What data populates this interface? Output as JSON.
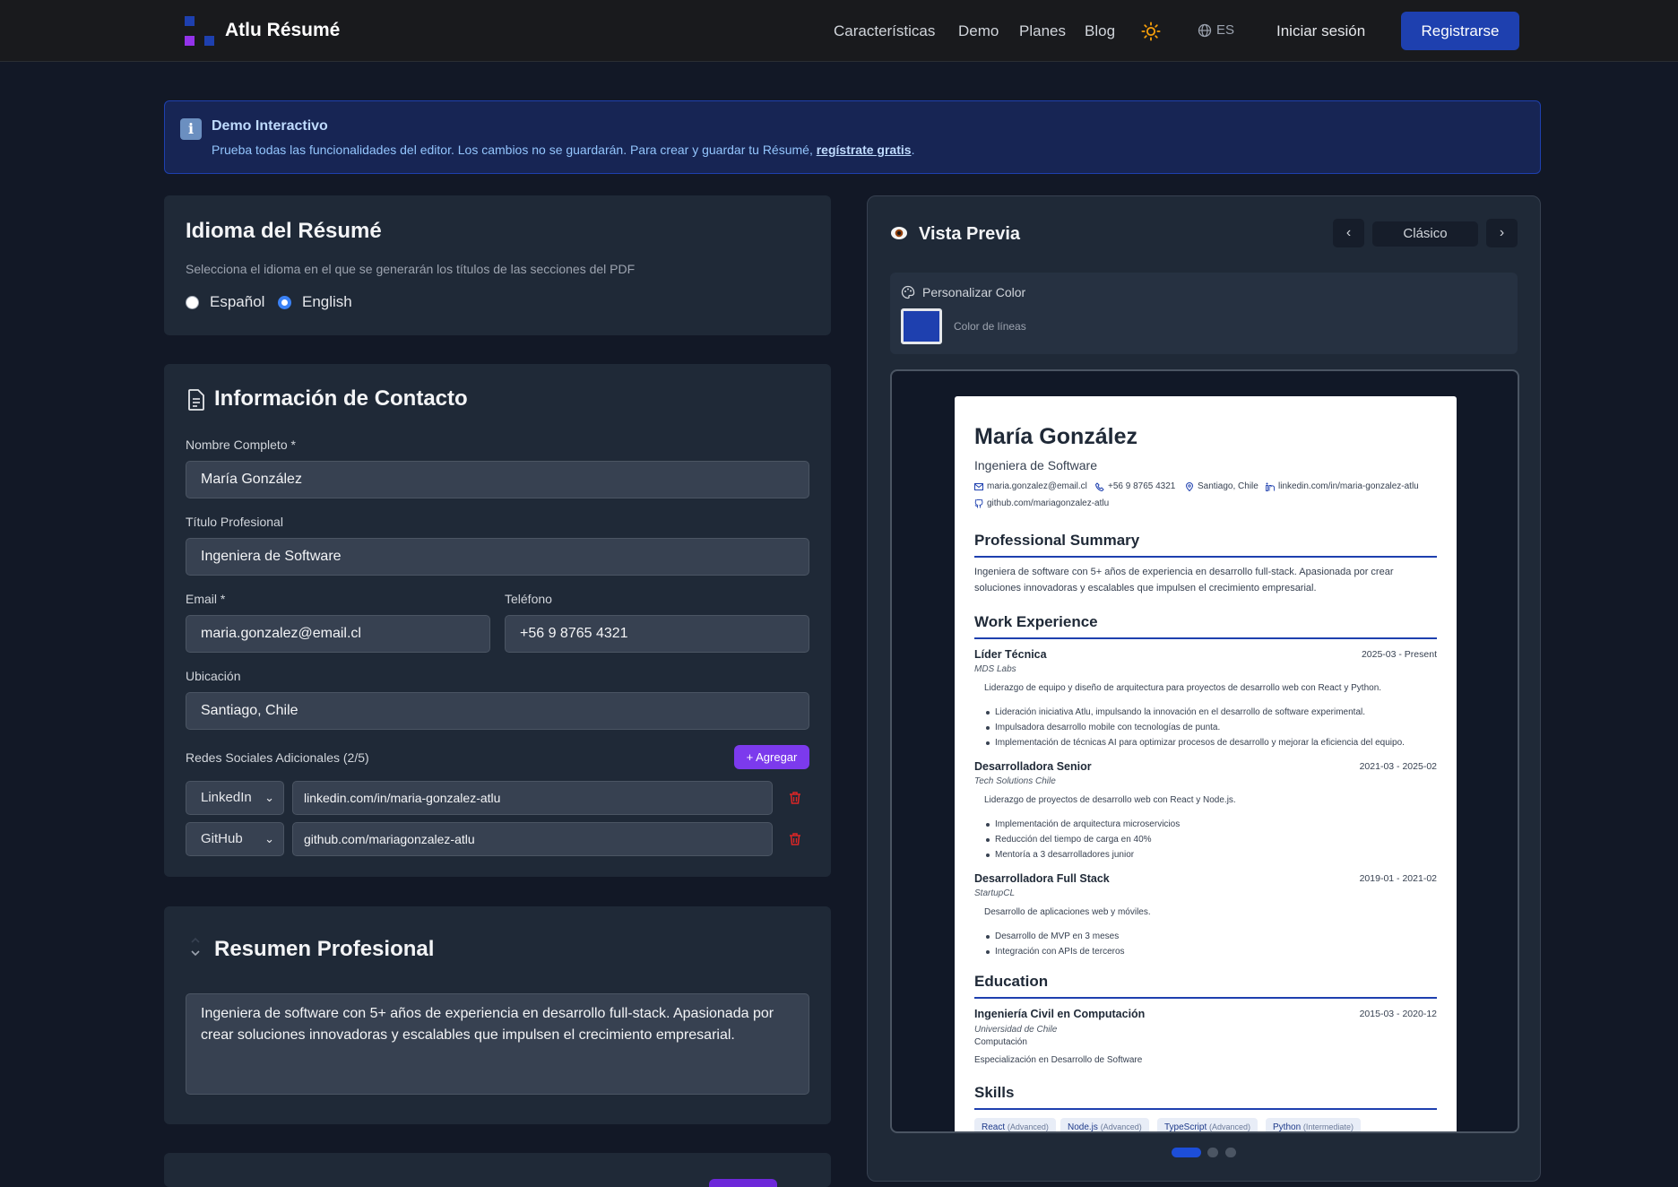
{
  "header": {
    "brand": "Atlu Résumé",
    "nav": [
      "Características",
      "Demo",
      "Planes",
      "Blog"
    ],
    "language": "ES",
    "login": "Iniciar sesión",
    "signup": "Registrarse"
  },
  "banner": {
    "title": "Demo Interactivo",
    "text": "Prueba todas las funcionalidades del editor. Los cambios no se guardarán. Para crear y guardar tu Résumé,",
    "link": "regístrate gratis",
    "period": "."
  },
  "language_card": {
    "title": "Idioma del Résumé",
    "subtitle": "Selecciona el idioma en el que se generarán los títulos de las secciones del PDF",
    "options": [
      "Español",
      "English"
    ],
    "selected": "English"
  },
  "contact": {
    "title": "Información de Contacto",
    "name_label": "Nombre Completo *",
    "name_value": "María González",
    "title_label": "Título Profesional",
    "title_value": "Ingeniera de Software",
    "email_label": "Email *",
    "email_value": "maria.gonzalez@email.cl",
    "phone_label": "Teléfono",
    "phone_value": "+56 9 8765 4321",
    "location_label": "Ubicación",
    "location_value": "Santiago, Chile",
    "social_label": "Redes Sociales Adicionales (2/5)",
    "add_button": "+ Agregar",
    "socials": [
      {
        "network": "LinkedIn",
        "url": "linkedin.com/in/maria-gonzalez-atlu"
      },
      {
        "network": "GitHub",
        "url": "github.com/mariagonzalez-atlu"
      }
    ]
  },
  "summary_card": {
    "title": "Resumen Profesional",
    "text": "Ingeniera de software con 5+ años de experiencia en desarrollo full-stack. Apasionada por crear soluciones innovadoras y escalables que impulsen el crecimiento empresarial."
  },
  "preview": {
    "title": "Vista Previa",
    "template": "Clásico",
    "customize_label": "Personalizar Color",
    "line_color_label": "Color de líneas",
    "line_color": "#1e40af"
  },
  "resume": {
    "name": "María González",
    "role": "Ingeniera de Software",
    "email": "maria.gonzalez@email.cl",
    "phone": "+56 9 8765 4321",
    "location": "Santiago, Chile",
    "linkedin": "linkedin.com/in/maria-gonzalez-atlu",
    "github": "github.com/mariagonzalez-atlu",
    "summary_heading": "Professional Summary",
    "summary": "Ingeniera de software con 5+ años de experiencia en desarrollo full-stack. Apasionada por crear soluciones innovadoras y escalables que impulsen el crecimiento empresarial.",
    "experience_heading": "Work Experience",
    "jobs": [
      {
        "title": "Líder Técnica",
        "dates": "2025-03 - Present",
        "company": "MDS Labs",
        "description": "Liderazgo de equipo y diseño de arquitectura para proyectos de desarrollo web con React y Python.",
        "bullets": [
          "Lideración iniciativa Atlu, impulsando la innovación en el desarrollo de software experimental.",
          "Impulsadora desarrollo mobile con tecnologías de punta.",
          "Implementación de técnicas AI para optimizar procesos de desarrollo y mejorar la eficiencia del equipo."
        ]
      },
      {
        "title": "Desarrolladora Senior",
        "dates": "2021-03 - 2025-02",
        "company": "Tech Solutions Chile",
        "description": "Liderazgo de proyectos de desarrollo web con React y Node.js.",
        "bullets": [
          "Implementación de arquitectura microservicios",
          "Reducción del tiempo de carga en 40%",
          "Mentoría a 3 desarrolladores junior"
        ]
      },
      {
        "title": "Desarrolladora Full Stack",
        "dates": "2019-01 - 2021-02",
        "company": "StartupCL",
        "description": "Desarrollo de aplicaciones web y móviles.",
        "bullets": [
          "Desarrollo de MVP en 3 meses",
          "Integración con APIs de terceros"
        ]
      }
    ],
    "education_heading": "Education",
    "education": {
      "degree": "Ingeniería Civil en Computación",
      "dates": "2015-03 - 2020-12",
      "school": "Universidad de Chile",
      "field": "Computación",
      "specialization": "Especialización en Desarrollo de Software"
    },
    "skills_heading": "Skills",
    "skills": [
      {
        "name": "React",
        "level": "(Advanced)"
      },
      {
        "name": "Node.js",
        "level": "(Advanced)"
      },
      {
        "name": "TypeScript",
        "level": "(Advanced)"
      },
      {
        "name": "Python",
        "level": "(Intermediate)"
      }
    ]
  },
  "colors": {
    "accent": "#1e40af",
    "add_button": "#7c3aed",
    "background": "#121826",
    "card": "#1f2937"
  }
}
